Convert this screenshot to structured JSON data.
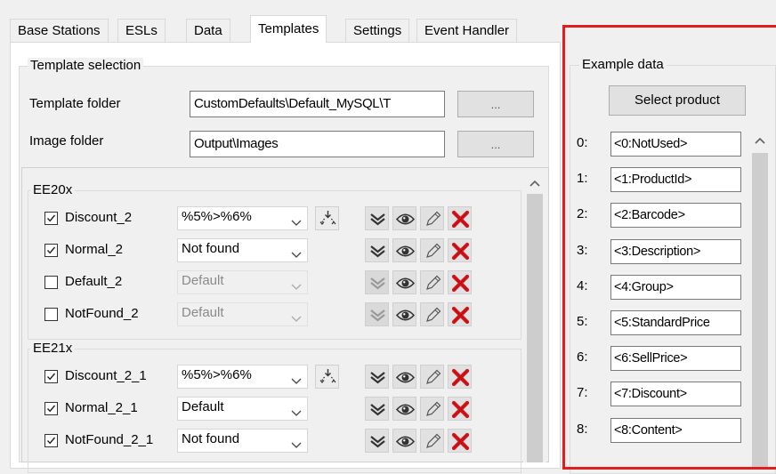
{
  "tabs": [
    {
      "label": "Base Stations"
    },
    {
      "label": "ESLs"
    },
    {
      "label": "Data"
    },
    {
      "label": "Templates"
    },
    {
      "label": "Settings"
    },
    {
      "label": "Event Handler"
    }
  ],
  "template_selection": {
    "title": "Template selection",
    "template_folder_label": "Template folder",
    "template_folder_value": "CustomDefaults\\Default_MySQL\\T",
    "image_folder_label": "Image folder",
    "image_folder_value": "Output\\Images",
    "browse_label": "..."
  },
  "groups": [
    {
      "title": "EE20x",
      "rows": [
        {
          "name": "Discount_2",
          "checked": true,
          "value": "%5%>%6%",
          "enabled": true,
          "has_extra": true
        },
        {
          "name": "Normal_2",
          "checked": true,
          "value": "Not found",
          "enabled": true,
          "has_extra": false
        },
        {
          "name": "Default_2",
          "checked": false,
          "value": "Default",
          "enabled": false,
          "has_extra": false
        },
        {
          "name": "NotFound_2",
          "checked": false,
          "value": "Default",
          "enabled": false,
          "has_extra": false
        }
      ]
    },
    {
      "title": "EE21x",
      "rows": [
        {
          "name": "Discount_2_1",
          "checked": true,
          "value": "%5%>%6%",
          "enabled": true,
          "has_extra": true
        },
        {
          "name": "Normal_2_1",
          "checked": true,
          "value": "Default",
          "enabled": true,
          "has_extra": false
        },
        {
          "name": "NotFound_2_1",
          "checked": true,
          "value": "Not found",
          "enabled": true,
          "has_extra": false
        }
      ]
    }
  ],
  "example_data": {
    "title": "Example data",
    "select_product_label": "Select product",
    "fields": [
      {
        "index": "0:",
        "value": "<0:NotUsed>"
      },
      {
        "index": "1:",
        "value": "<1:ProductId>"
      },
      {
        "index": "2:",
        "value": "<2:Barcode>"
      },
      {
        "index": "3:",
        "value": "<3:Description>"
      },
      {
        "index": "4:",
        "value": "<4:Group>"
      },
      {
        "index": "5:",
        "value": "<5:StandardPrice"
      },
      {
        "index": "6:",
        "value": "<6:SellPrice>"
      },
      {
        "index": "7:",
        "value": "<7:Discount>"
      },
      {
        "index": "8:",
        "value": "<8:Content>"
      }
    ]
  },
  "icons": {
    "checkbox_check": "check-icon",
    "dropdown": "chevron-down-icon",
    "collapse": "double-chevron-down-icon",
    "preview": "eye-icon",
    "edit": "pencil-icon",
    "delete": "red-x-icon",
    "reload": "reload-icon"
  },
  "colors": {
    "highlight_frame": "#e01e1e",
    "delete": "#d4141a"
  }
}
